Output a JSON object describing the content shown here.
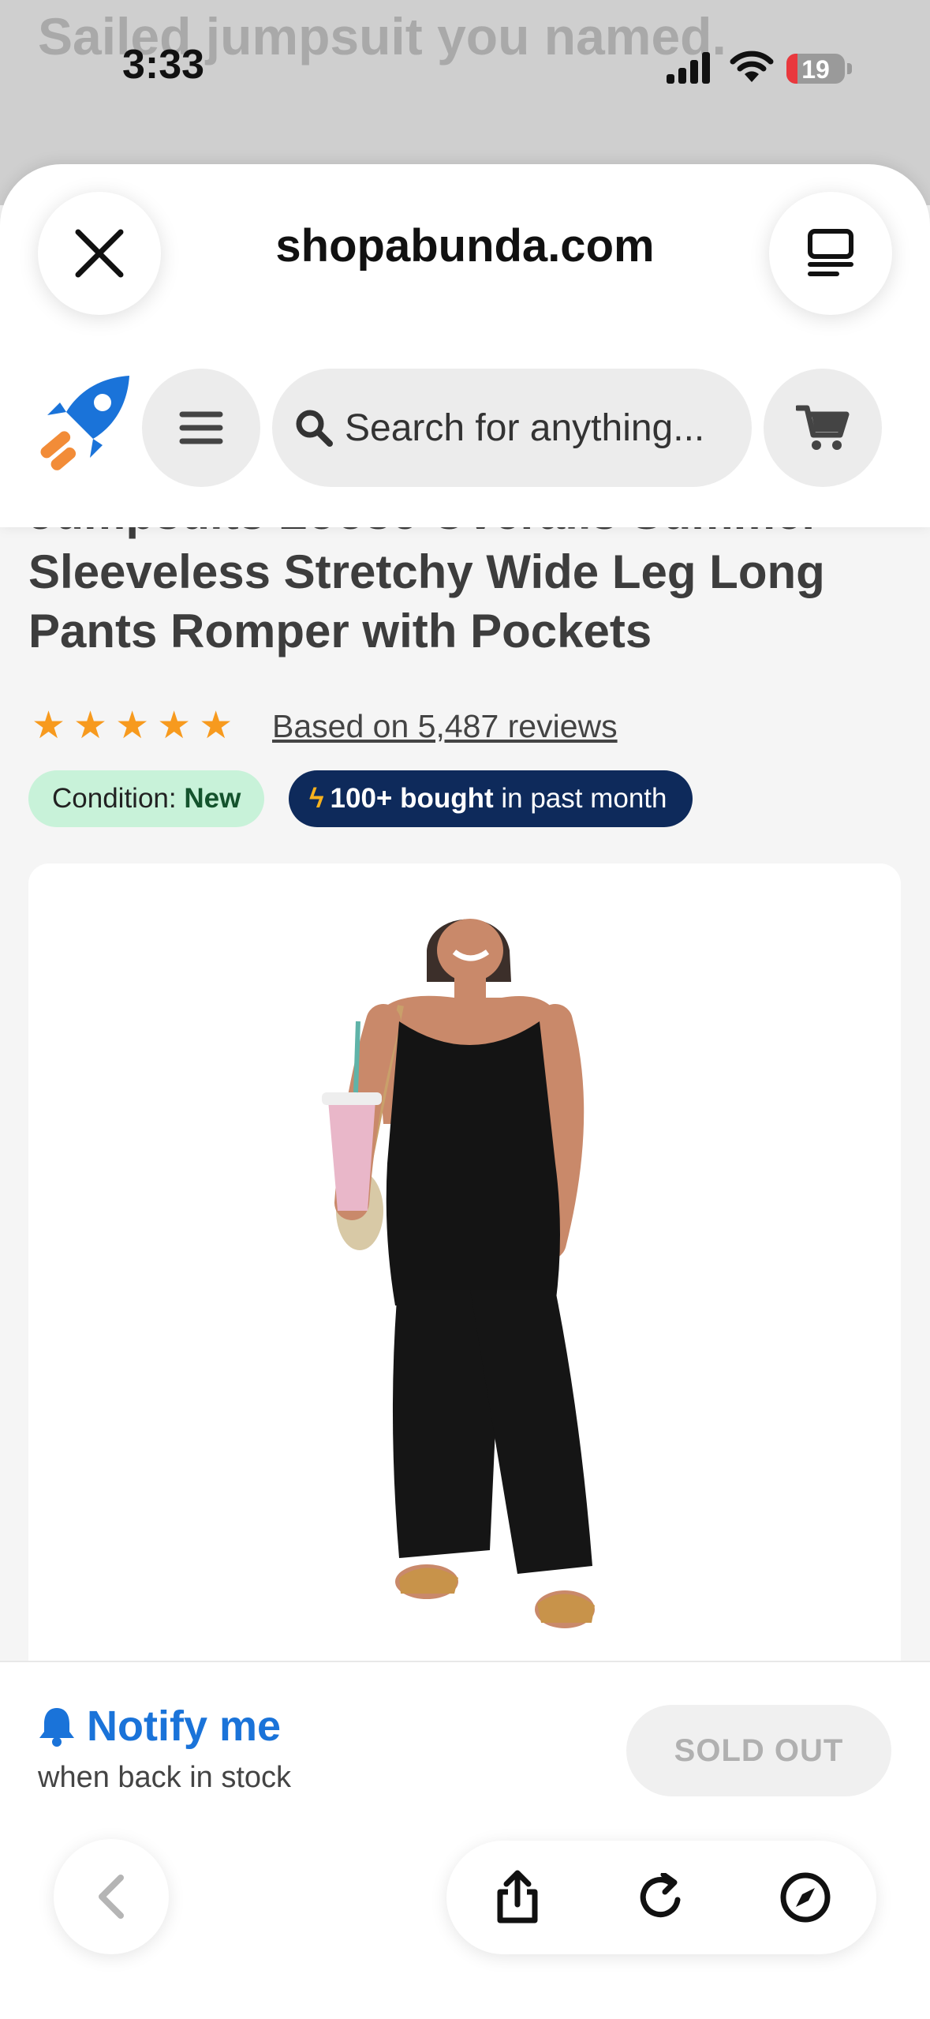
{
  "background": {
    "title": "Sailed jumpsuit you named."
  },
  "status_bar": {
    "time": "3:33",
    "battery": "19",
    "battery_level": 0.19
  },
  "browser": {
    "domain": "shopabunda.com"
  },
  "site": {
    "search_placeholder": "Search for anything..."
  },
  "product": {
    "title_lines": [
      "Jumpsuits Loose Overalls Summer",
      "Sleeveless Stretchy Wide Leg Long",
      "Pants Romper with Pockets"
    ],
    "rating": 5,
    "reviews": "Based on 5,487 reviews",
    "condition_label": "Condition: ",
    "condition_value": "New",
    "bought_bold": "100+ bought",
    "bought_rest": " in past month"
  },
  "footer": {
    "notify_label": "Notify me",
    "notify_sub": "when back in stock",
    "sold_out": "SOLD OUT"
  },
  "colors": {
    "accent": "#1a73d9",
    "navy": "#0e2a5b",
    "star": "#f79a1e",
    "condition_bg": "#c8f2d9"
  },
  "icons": [
    "close-icon",
    "reader-mode-icon",
    "rocket-logo-icon",
    "menu-icon",
    "search-icon",
    "cart-icon",
    "bell-icon",
    "bolt-icon",
    "chevron-left-icon",
    "share-icon",
    "reload-icon",
    "compass-icon"
  ]
}
